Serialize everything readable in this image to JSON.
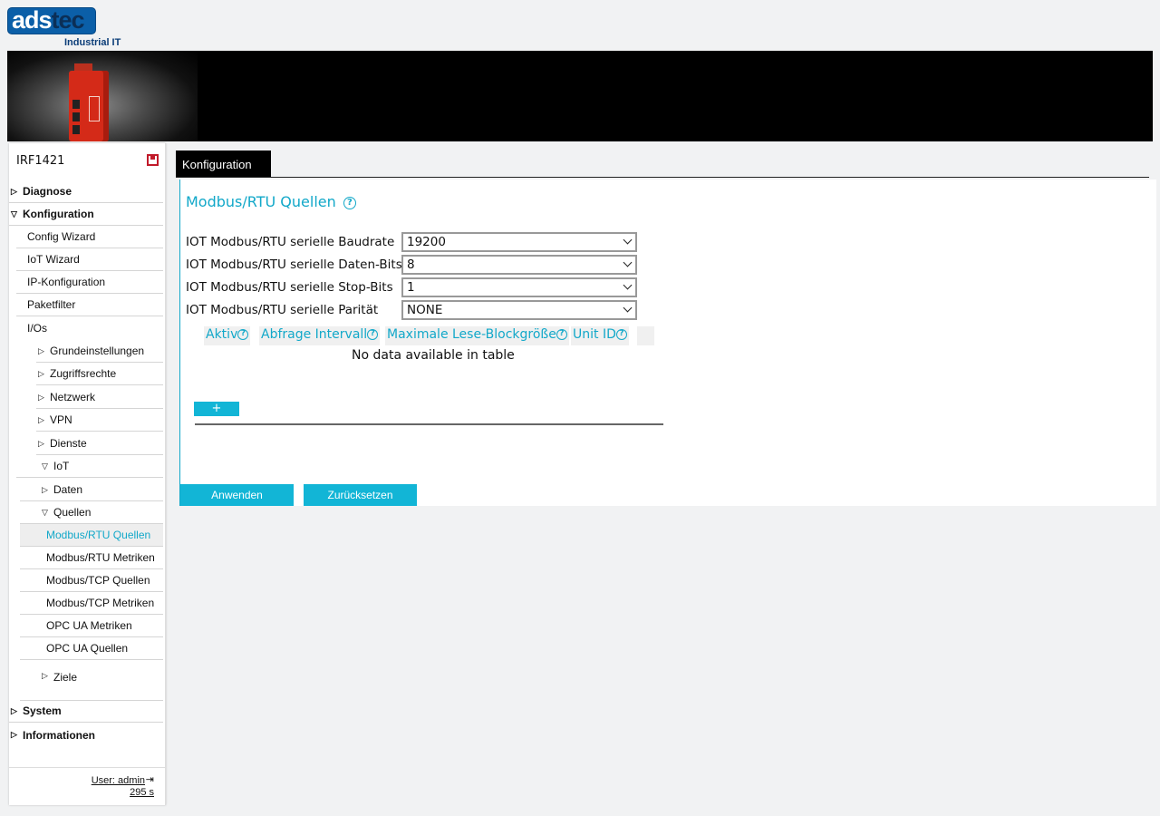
{
  "brand": {
    "logo_part1": "ads",
    "logo_part2": "tec",
    "tagline": "Industrial IT"
  },
  "sidebar": {
    "device_name": "IRF1421",
    "items": [
      {
        "label": "Diagnose",
        "bold": true,
        "expanded": false
      },
      {
        "label": "Konfiguration",
        "bold": true,
        "expanded": true
      },
      {
        "label": "Config Wizard"
      },
      {
        "label": "IoT Wizard"
      },
      {
        "label": "IP-Konfiguration"
      },
      {
        "label": "Paketfilter"
      },
      {
        "label": "I/Os"
      },
      {
        "label": "Grundeinstellungen",
        "expanded": false
      },
      {
        "label": "Zugriffsrechte",
        "expanded": false
      },
      {
        "label": "Netzwerk",
        "expanded": false
      },
      {
        "label": "VPN",
        "expanded": false
      },
      {
        "label": "Dienste",
        "expanded": false
      },
      {
        "label": "IoT",
        "expanded": true
      },
      {
        "label": "Daten",
        "expanded": false
      },
      {
        "label": "Quellen",
        "expanded": true
      },
      {
        "label": "Modbus/RTU Quellen",
        "active": true
      },
      {
        "label": "Modbus/RTU Metriken"
      },
      {
        "label": "Modbus/TCP Quellen"
      },
      {
        "label": "Modbus/TCP Metriken"
      },
      {
        "label": "OPC UA Metriken"
      },
      {
        "label": "OPC UA Quellen"
      },
      {
        "label": "Ziele",
        "expanded": false
      },
      {
        "label": "System",
        "bold": true,
        "expanded": false
      },
      {
        "label": "Informationen",
        "bold": true,
        "expanded": false
      }
    ],
    "user_label": "User: admin",
    "session_timer": "295 s"
  },
  "tabs": [
    {
      "label": "Konfiguration",
      "active": true
    }
  ],
  "main": {
    "title": "Modbus/RTU Quellen",
    "help_glyph": "?",
    "fields": [
      {
        "label": "IOT Modbus/RTU serielle Baudrate",
        "value": "19200"
      },
      {
        "label": "IOT Modbus/RTU serielle Daten-Bits",
        "value": "8"
      },
      {
        "label": "IOT Modbus/RTU serielle Stop-Bits",
        "value": "1"
      },
      {
        "label": "IOT Modbus/RTU serielle Parität",
        "value": "NONE"
      }
    ],
    "table": {
      "columns": [
        "Aktiv",
        "Abfrage Intervall",
        "Maximale Lese-Blockgröße",
        "Unit ID"
      ],
      "empty_text": "No data available in table",
      "add_label": "+"
    },
    "apply_label": "Anwenden",
    "reset_label": "Zurücksetzen"
  },
  "colors": {
    "accent": "#12a8c9",
    "button": "#12b5d6",
    "logo_blue": "#0b5fa8",
    "device_red": "#d42a18"
  }
}
